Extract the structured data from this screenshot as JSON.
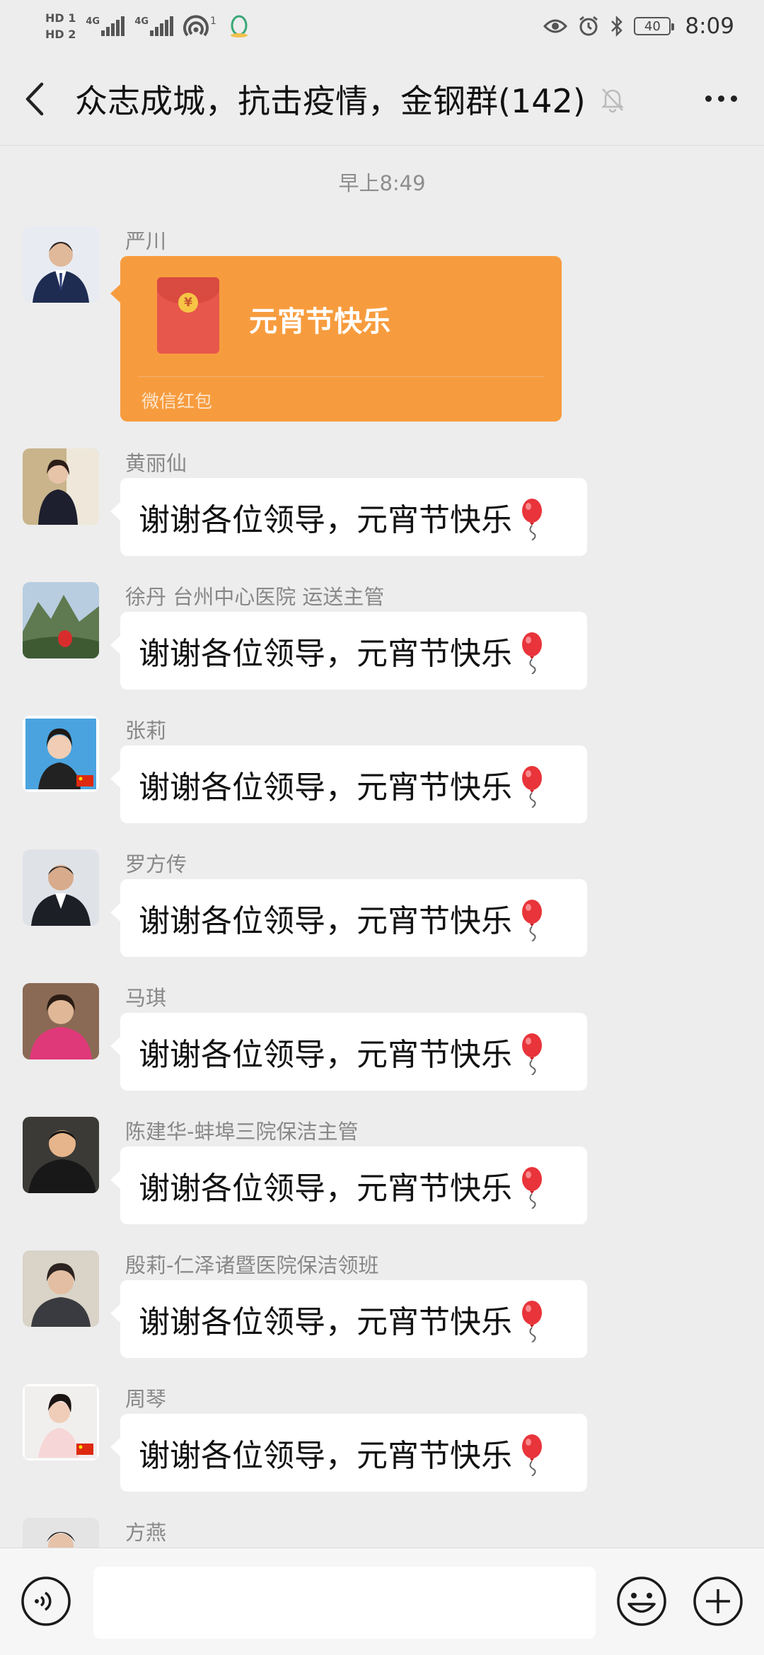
{
  "status_bar": {
    "hd_labels": [
      "HD 1",
      "HD 2"
    ],
    "network_labels": [
      "4G",
      "4G"
    ],
    "wifi_badge": "1",
    "battery": "40",
    "time": "8:09"
  },
  "header": {
    "title": "众志成城，抗击疫情，金钢群(142)"
  },
  "chat": {
    "timestamp": "早上8:49",
    "red_packet": {
      "sender": "严川",
      "title": "元宵节快乐",
      "footer": "微信红包",
      "coin": "¥"
    },
    "messages": [
      {
        "sender": "黄丽仙",
        "text": "谢谢各位领导，元宵节快乐"
      },
      {
        "sender": "徐丹 台州中心医院 运送主管",
        "text": "谢谢各位领导，元宵节快乐"
      },
      {
        "sender": "张莉",
        "text": "谢谢各位领导，元宵节快乐"
      },
      {
        "sender": "罗方传",
        "text": "谢谢各位领导，元宵节快乐"
      },
      {
        "sender": "马琪",
        "text": "谢谢各位领导，元宵节快乐"
      },
      {
        "sender": "陈建华-蚌埠三院保洁主管",
        "text": "谢谢各位领导，元宵节快乐"
      },
      {
        "sender": "殷莉-仁泽诸暨医院保洁领班",
        "text": "谢谢各位领导，元宵节快乐"
      },
      {
        "sender": "周琴",
        "text": "谢谢各位领导，元宵节快乐"
      }
    ],
    "last_sender": "方燕"
  },
  "colors": {
    "background": "#ededed",
    "red_packet": "#f79c3e",
    "bubble": "#ffffff"
  }
}
